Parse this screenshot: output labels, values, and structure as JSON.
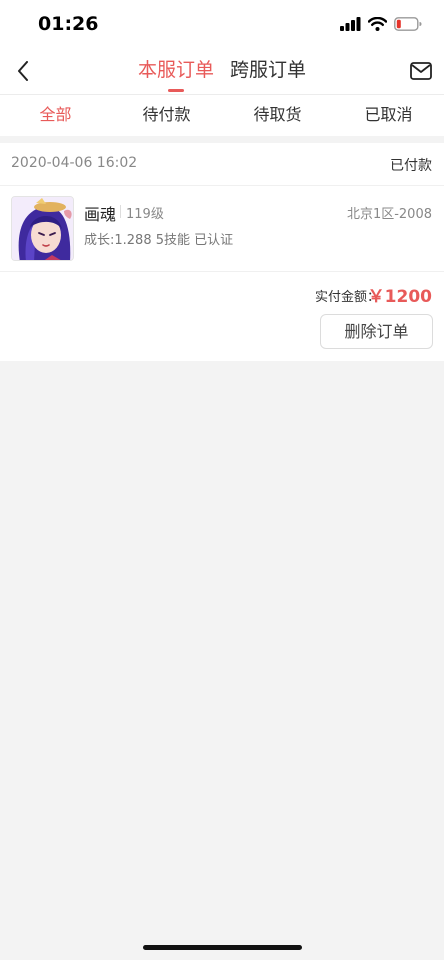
{
  "status_bar": {
    "time": "01:26"
  },
  "header": {
    "tabs": [
      {
        "label": "本服订单",
        "active": true
      },
      {
        "label": "跨服订单",
        "active": false
      }
    ]
  },
  "filters": {
    "tabs": [
      {
        "label": "全部",
        "active": true
      },
      {
        "label": "待付款",
        "active": false
      },
      {
        "label": "待取货",
        "active": false
      },
      {
        "label": "已取消",
        "active": false
      }
    ]
  },
  "order": {
    "date": "2020-04-06 16:02",
    "status": "已付款",
    "item": {
      "name": "画魂",
      "level": "119级",
      "server": "北京1区-2008",
      "attributes": "成长:1.288  5技能  已认证"
    },
    "total_label": "实付金额：",
    "total_amount": "￥1200",
    "delete_label": "删除订单"
  },
  "colors": {
    "accent": "#e85a59",
    "background": "#f3f3f3"
  },
  "icons": [
    "back-chevron-icon",
    "mail-icon",
    "signal-icon",
    "wifi-icon",
    "battery-icon"
  ]
}
